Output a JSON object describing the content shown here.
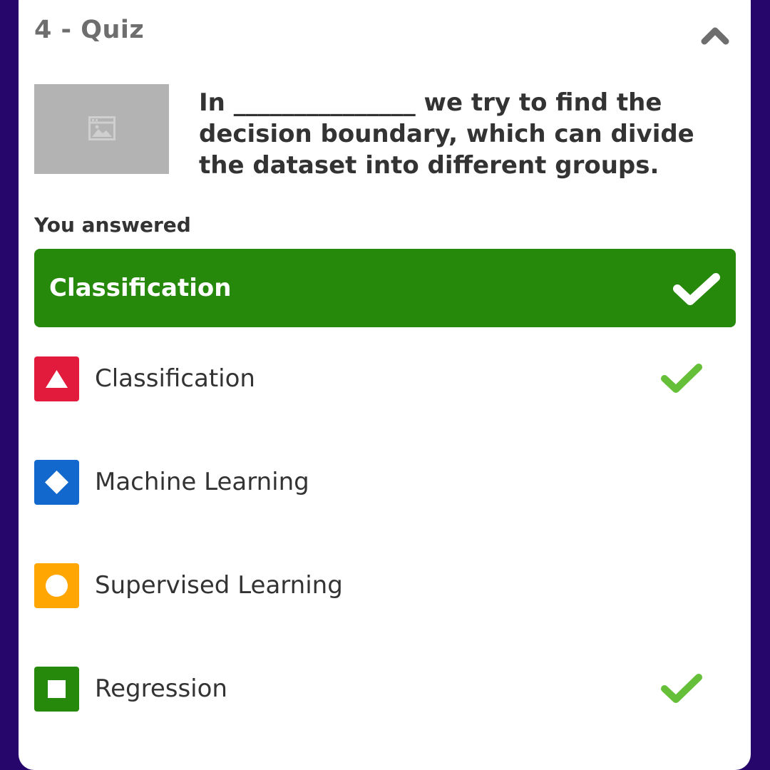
{
  "quiz": {
    "header": "4 - Quiz",
    "question": "In _______________ we try to find the decision boundary, which can divide the dataset into different groups.",
    "you_answered_label": "You answered",
    "selected_answer": "Classification"
  },
  "options": [
    {
      "label": "Classification",
      "shape": "triangle-icon",
      "color": "#e21b3c",
      "correct": true
    },
    {
      "label": "Machine Learning",
      "shape": "diamond-icon",
      "color": "#1368ce",
      "correct": false
    },
    {
      "label": "Supervised Learning",
      "shape": "circle-icon",
      "color": "#ffa602",
      "correct": false
    },
    {
      "label": "Regression",
      "shape": "square-icon",
      "color": "#26890c",
      "correct": true
    }
  ],
  "colors": {
    "background": "#26066b",
    "answer_bar": "#26890c",
    "check_green": "#66bf39"
  },
  "icons": {
    "collapse": "chevron-up-icon",
    "image": "image-placeholder-icon",
    "check": "checkmark-icon"
  }
}
